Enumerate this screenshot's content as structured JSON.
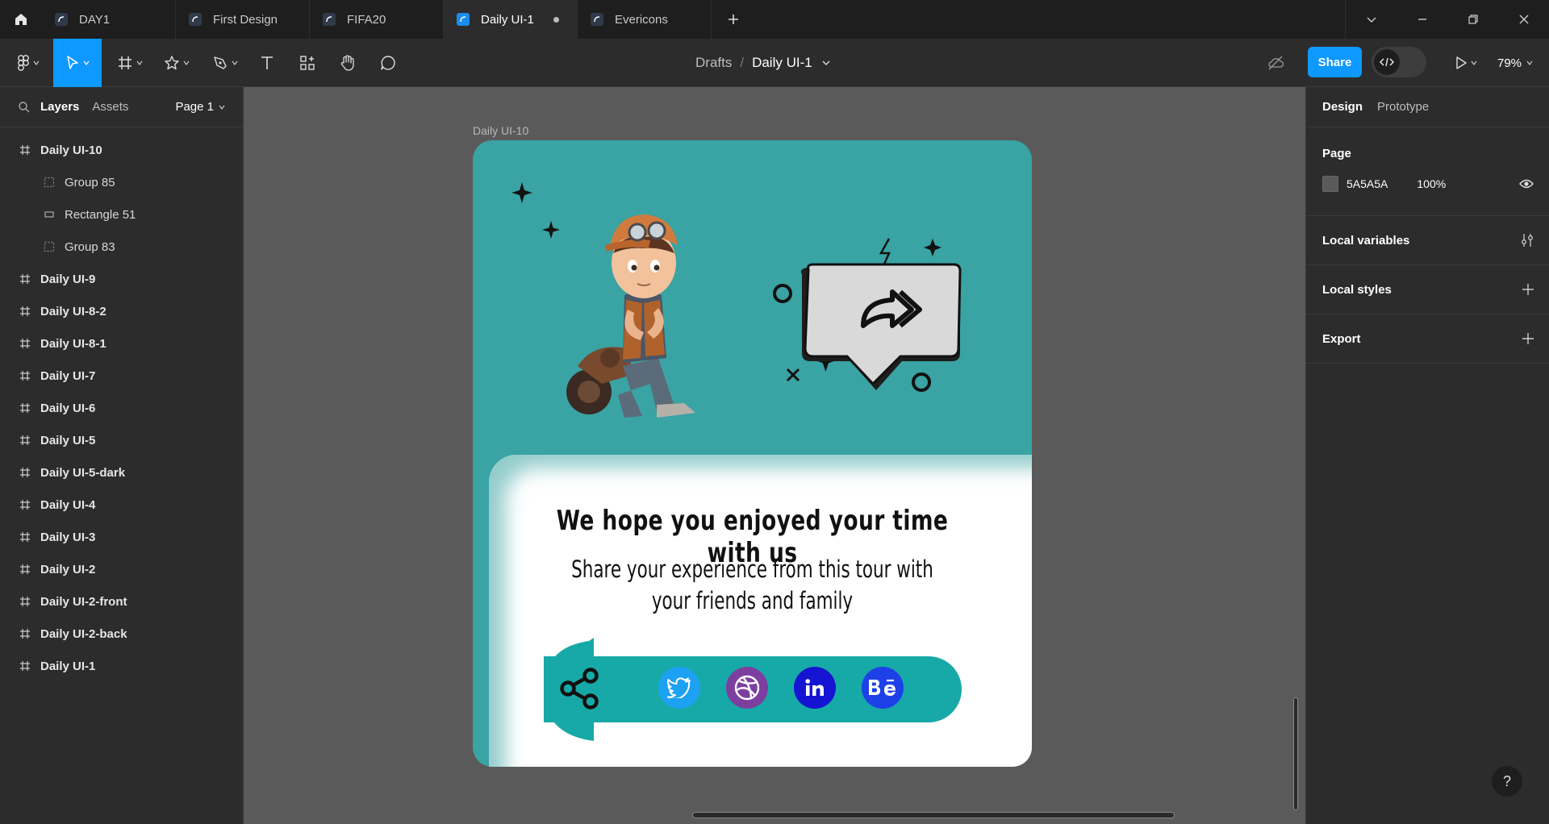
{
  "tabs": [
    {
      "label": "DAY1",
      "active": false
    },
    {
      "label": "First Design",
      "active": false
    },
    {
      "label": "FIFA20",
      "active": false
    },
    {
      "label": "Daily UI-1",
      "active": true
    },
    {
      "label": "Evericons",
      "active": false
    }
  ],
  "toolbar": {
    "breadcrumb_root": "Drafts",
    "breadcrumb_separator": "/",
    "file_name": "Daily UI-1",
    "share_label": "Share",
    "zoom": "79%"
  },
  "left_panel": {
    "tab_layers": "Layers",
    "tab_assets": "Assets",
    "page_selector": "Page 1",
    "layers": [
      {
        "label": "Daily UI-10",
        "type": "frame"
      },
      {
        "label": "Group 85",
        "type": "group"
      },
      {
        "label": "Rectangle 51",
        "type": "rect"
      },
      {
        "label": "Group 83",
        "type": "group"
      },
      {
        "label": "Daily UI-9",
        "type": "frame"
      },
      {
        "label": "Daily UI-8-2",
        "type": "frame"
      },
      {
        "label": "Daily UI-8-1",
        "type": "frame"
      },
      {
        "label": "Daily UI-7",
        "type": "frame"
      },
      {
        "label": "Daily UI-6",
        "type": "frame"
      },
      {
        "label": "Daily UI-5",
        "type": "frame"
      },
      {
        "label": "Daily UI-5-dark",
        "type": "frame"
      },
      {
        "label": "Daily UI-4",
        "type": "frame"
      },
      {
        "label": "Daily UI-3",
        "type": "frame"
      },
      {
        "label": "Daily UI-2",
        "type": "frame"
      },
      {
        "label": "Daily UI-2-front",
        "type": "frame"
      },
      {
        "label": "Daily UI-2-back",
        "type": "frame"
      },
      {
        "label": "Daily UI-1",
        "type": "frame"
      }
    ]
  },
  "canvas": {
    "background": "#5A5A5A",
    "frame_label": "Daily UI-10",
    "card": {
      "accent": "#3AA3A3",
      "headline": "We hope you enjoyed your  time with us",
      "sub_line1": "Share your experience from this tour with",
      "sub_line2": "your friends and family",
      "social_icons": [
        {
          "name": "twitter-icon",
          "color": "#1DA1F2"
        },
        {
          "name": "dribbble-icon",
          "color": "#7C3FA0"
        },
        {
          "name": "linkedin-icon",
          "color": "#1414D2"
        },
        {
          "name": "behance-icon",
          "color": "#1E40E8"
        }
      ]
    }
  },
  "right_panel": {
    "tab_design": "Design",
    "tab_prototype": "Prototype",
    "page_title": "Page",
    "page_color": "5A5A5A",
    "page_opacity": "100%",
    "local_variables": "Local variables",
    "local_styles": "Local styles",
    "export": "Export",
    "help": "?"
  }
}
